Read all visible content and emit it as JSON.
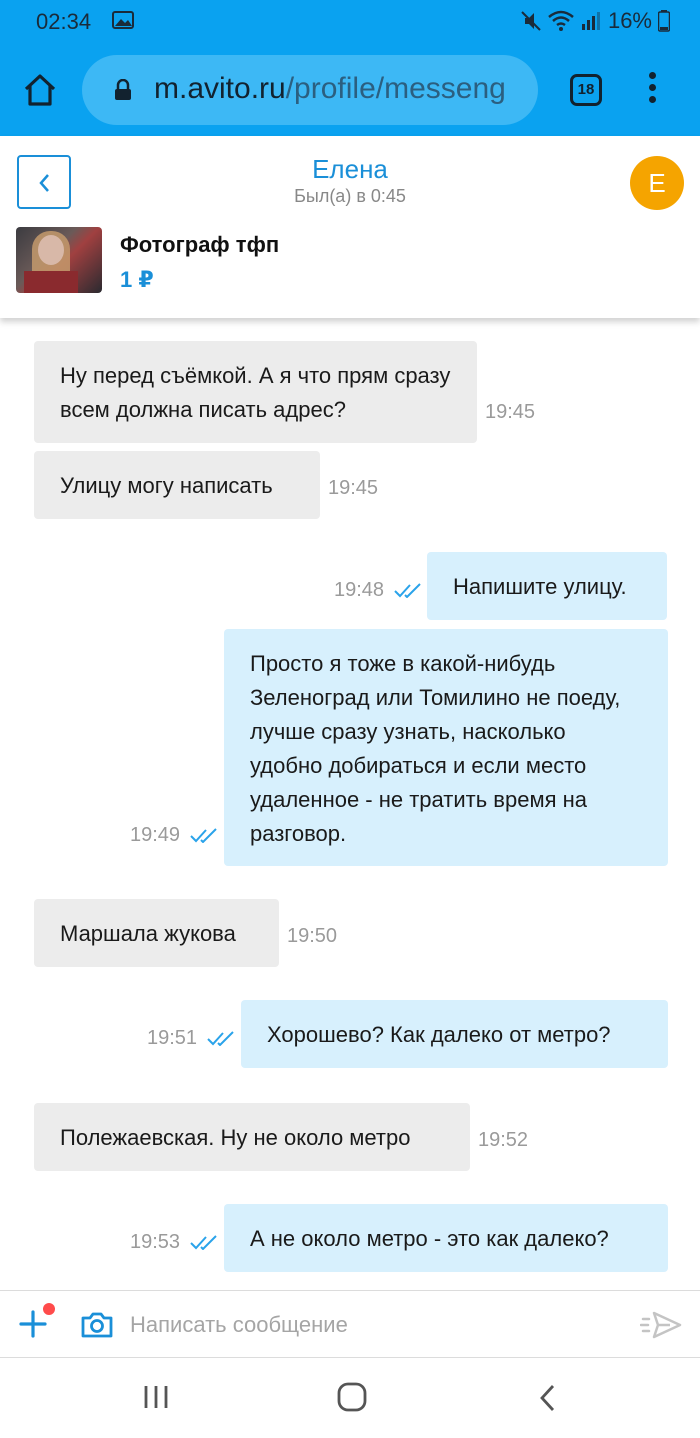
{
  "status_bar": {
    "time": "02:34",
    "battery": "16%"
  },
  "browser": {
    "url_host": "m.avito.ru",
    "url_path": "/profile/messeng",
    "tab_count": "18"
  },
  "chat_header": {
    "name": "Елена",
    "last_seen": "Был(а) в 0:45",
    "avatar_letter": "Е",
    "ad_title": "Фотограф тфп",
    "ad_price": "1 ₽"
  },
  "messages": [
    {
      "dir": "in",
      "text": "Ну перед съёмкой. А я что прям сразу всем должна писать адрес?",
      "time": "19:45"
    },
    {
      "dir": "in",
      "text": "Улицу могу написать",
      "time": "19:45"
    },
    {
      "dir": "out",
      "text": "Напишите улицу.",
      "time": "19:48",
      "read": true
    },
    {
      "dir": "out",
      "text": "Просто я тоже в какой-нибудь Зеленоград или Томилино не поеду, лучше сразу узнать, насколько удобно добираться и если место удаленное - не тратить время на разговор.",
      "time": "19:49",
      "read": true
    },
    {
      "dir": "in",
      "text": "Маршала жукова",
      "time": "19:50"
    },
    {
      "dir": "out",
      "text": "Хорошево? Как далеко от метро?",
      "time": "19:51",
      "read": true
    },
    {
      "dir": "in",
      "text": "Полежаевская. Ну не около метро",
      "time": "19:52"
    },
    {
      "dir": "out",
      "text": "А не около метро - это как далеко?",
      "time": "19:53",
      "read": true
    }
  ],
  "composer": {
    "placeholder": "Написать сообщение"
  },
  "colors": {
    "browser_bar": "#0aa2f0",
    "accent": "#1a8fd8",
    "avatar": "#f5a400",
    "incoming_bubble": "#ececec",
    "outgoing_bubble": "#d7f0fd"
  }
}
